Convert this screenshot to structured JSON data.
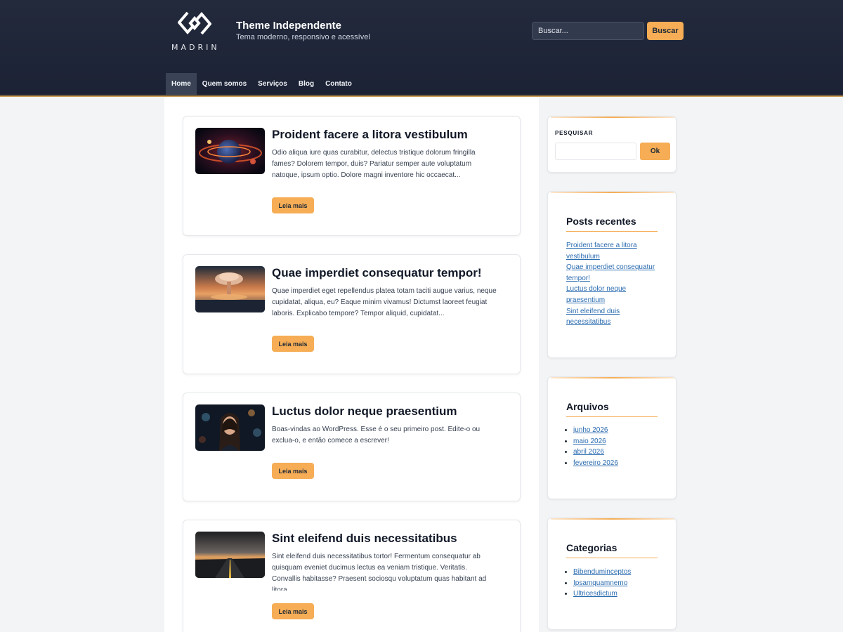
{
  "site": {
    "logo_text": "MADRIN",
    "title": "Theme Independente",
    "description": "Tema moderno, responsivo e acessível"
  },
  "header_search": {
    "placeholder": "Buscar...",
    "button": "Buscar"
  },
  "nav": [
    "Home",
    "Quem somos",
    "Serviços",
    "Blog",
    "Contato"
  ],
  "posts": [
    {
      "title": "Proident facere a litora vestibulum",
      "excerpt": "Odio aliqua iure quas curabitur, delectus tristique dolorum fringilla fames? Dolorem tempor, duis? Pariatur semper aute voluptatum natoque, ipsum optio. Dolore magni inventore hic occaecat...",
      "read_more": "Leia mais"
    },
    {
      "title": "Quae imperdiet consequatur tempor!",
      "excerpt": "Quae imperdiet eget repellendus platea totam taciti augue varius, neque cupidatat, aliqua, eu? Eaque minim vivamus! Dictumst laoreet feugiat laboris. Explicabo tempore? Tempor aliquid, cupidatat...",
      "read_more": "Leia mais"
    },
    {
      "title": "Luctus dolor neque praesentium",
      "excerpt": "Boas-vindas ao WordPress. Esse é o seu primeiro post. Edite-o ou exclua-o, e então comece a escrever!",
      "read_more": "Leia mais"
    },
    {
      "title": "Sint eleifend duis necessitatibus",
      "excerpt": "Sint eleifend duis necessitatibus tortor! Fermentum consequatur ab quisquam eveniet ducimus lectus ea veniam tristique. Veritatis. Convallis habitasse? Praesent sociosqu voluptatum quas habitant ad litora...",
      "read_more": "Leia mais"
    }
  ],
  "sidebar": {
    "search": {
      "label": "PESQUISAR",
      "button": "Ok"
    },
    "recent": {
      "title": "Posts recentes",
      "items": [
        "Proident facere a litora vestibulum",
        "Quae imperdiet consequatur tempor!",
        "Luctus dolor neque praesentium",
        "Sint eleifend duis necessitatibus"
      ]
    },
    "archives": {
      "title": "Arquivos",
      "items": [
        "junho 2026",
        "maio 2026",
        "abril 2026",
        "fevereiro 2026"
      ]
    },
    "categories": {
      "title": "Categorias",
      "items": [
        "Bibenduminceptos",
        "Ipsamquamnemo",
        "Ultricesdictum"
      ]
    }
  },
  "colors": {
    "header_bg": "#1f2637",
    "accent": "#f6ad55",
    "link": "#2b6cb0"
  }
}
